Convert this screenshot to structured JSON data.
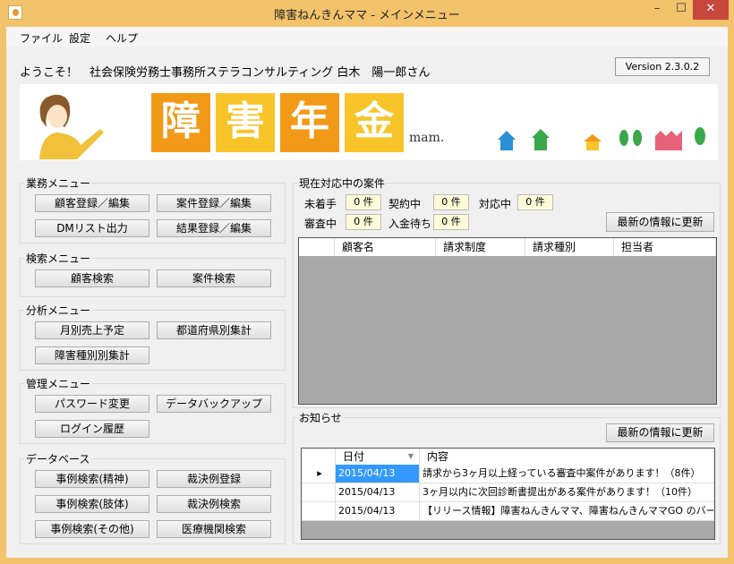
{
  "window": {
    "title": "障害ねんきんママ - メインメニュー",
    "controls": {
      "minimize": "–",
      "maximize": "☐",
      "close": "✕"
    }
  },
  "menu": {
    "file": "ファイル",
    "settings": "設定",
    "help": "ヘルプ"
  },
  "header": {
    "welcome": "ようこそ！　社会保険労務士事務所ステラコンサルティング 白木　陽一郎さん",
    "version": "Version 2.3.0.2"
  },
  "banner": {
    "logo_chars": [
      "障",
      "害",
      "年",
      "金"
    ],
    "tagline": "mam."
  },
  "groups": {
    "business": {
      "label": "業務メニュー",
      "buttons": [
        "顧客登録／編集",
        "案件登録／編集",
        "DMリスト出力",
        "結果登録／編集"
      ]
    },
    "search": {
      "label": "検索メニュー",
      "buttons": [
        "顧客検索",
        "案件検索"
      ]
    },
    "analysis": {
      "label": "分析メニュー",
      "buttons": [
        "月別売上予定",
        "都道府県別集計",
        "障害種別別集計"
      ]
    },
    "admin": {
      "label": "管理メニュー",
      "buttons": [
        "パスワード変更",
        "データバックアップ",
        "ログイン履歴"
      ]
    },
    "database": {
      "label": "データベース",
      "buttons": [
        "事例検索(精神)",
        "裁決例登録",
        "事例検索(肢体)",
        "裁決例検索",
        "事例検索(その他)",
        "医療機関検索"
      ]
    }
  },
  "cases": {
    "label": "現在対応中の案件",
    "statuses": [
      {
        "label": "未着手",
        "value": "0 件"
      },
      {
        "label": "契約中",
        "value": "0 件"
      },
      {
        "label": "対応中",
        "value": "0 件"
      },
      {
        "label": "審査中",
        "value": "0 件"
      },
      {
        "label": "入金待ち",
        "value": "0 件"
      }
    ],
    "refresh_label": "最新の情報に更新",
    "columns": [
      "顧客名",
      "請求制度",
      "請求種別",
      "担当者"
    ]
  },
  "news": {
    "label": "お知らせ",
    "refresh_label": "最新の情報に更新",
    "columns": [
      "日付",
      "内容"
    ],
    "rows": [
      {
        "date": "2015/04/13",
        "content": "請求から3ヶ月以上経っている審査中案件があります！（8件）"
      },
      {
        "date": "2015/04/13",
        "content": "3ヶ月以内に次回診断書提出がある案件があります！（10件）"
      },
      {
        "date": "2015/04/13",
        "content": "【リリース情報】障害ねんきんママ、障害ねんきんママGO のバージョンア..."
      }
    ]
  }
}
